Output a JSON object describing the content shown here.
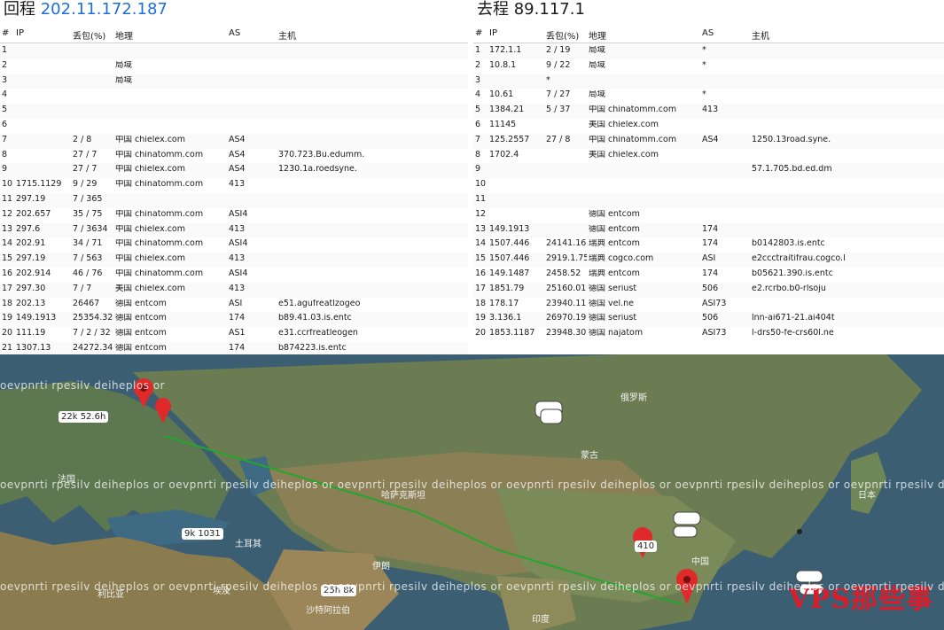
{
  "left": {
    "title_prefix": "回程",
    "title_ip": "202.11.172.187",
    "headers": {
      "hop": "#",
      "ip": "IP",
      "loss": "丢包(%)",
      "geo": "地理",
      "as": "AS",
      "host": "主机"
    },
    "rows": [
      {
        "hop": "1",
        "ip": "",
        "loss": "",
        "geo": "",
        "as": "",
        "host": ""
      },
      {
        "hop": "2",
        "ip": "",
        "loss": "",
        "geo": "局域",
        "as": "",
        "host": ""
      },
      {
        "hop": "3",
        "ip": "",
        "loss": "",
        "geo": "局域",
        "as": "",
        "host": ""
      },
      {
        "hop": "4",
        "ip": "",
        "loss": "",
        "geo": "",
        "as": "",
        "host": ""
      },
      {
        "hop": "5",
        "ip": "",
        "loss": "",
        "geo": "",
        "as": "",
        "host": ""
      },
      {
        "hop": "6",
        "ip": "",
        "loss": "",
        "geo": "",
        "as": "",
        "host": ""
      },
      {
        "hop": "7",
        "ip": "",
        "loss": "2 / 8",
        "geo": "中国 chielex.com",
        "as": "AS4",
        "host": ""
      },
      {
        "hop": "8",
        "ip": "",
        "loss": "27 / 7",
        "geo": "中国 chinatomm.com",
        "as": "AS4",
        "host": "370.723.Bu.edumm."
      },
      {
        "hop": "9",
        "ip": "",
        "loss": "27 / 7",
        "geo": "中国 chielex.com",
        "as": "AS4",
        "host": "1230.1a.roedsyne."
      },
      {
        "hop": "10",
        "ip": "1715.1129",
        "loss": "9 / 29",
        "geo": "中国 chinatomm.com",
        "as": "413",
        "host": ""
      },
      {
        "hop": "11",
        "ip": "297.19",
        "loss": "7 / 365",
        "geo": "",
        "as": "",
        "host": ""
      },
      {
        "hop": "12",
        "ip": "202.657",
        "loss": "35 / 75",
        "geo": "中国 chinatomm.com",
        "as": "ASI4",
        "host": ""
      },
      {
        "hop": "13",
        "ip": "297.6",
        "loss": "7 / 3634",
        "geo": "中国 chielex.com",
        "as": "413",
        "host": ""
      },
      {
        "hop": "14",
        "ip": "202.91",
        "loss": "34 / 71",
        "geo": "中国 chinatomm.com",
        "as": "ASI4",
        "host": ""
      },
      {
        "hop": "15",
        "ip": "297.19",
        "loss": "7 / 563",
        "geo": "中国 chielex.com",
        "as": "413",
        "host": ""
      },
      {
        "hop": "16",
        "ip": "202.914",
        "loss": "46 / 76",
        "geo": "中国 chinatomm.com",
        "as": "ASI4",
        "host": ""
      },
      {
        "hop": "17",
        "ip": "297.30",
        "loss": "7 / 7",
        "geo": "美国 chielex.com",
        "as": "413",
        "host": ""
      },
      {
        "hop": "18",
        "ip": "202.13",
        "loss": "26467",
        "geo": "德国 entcom",
        "as": "ASI",
        "host": "e51.agufreatlzogeo"
      },
      {
        "hop": "19",
        "ip": "149.1913",
        "loss": "25354.32",
        "geo": "德国 entcom",
        "as": "174",
        "host": "b89.41.03.is.entc"
      },
      {
        "hop": "20",
        "ip": "111.19",
        "loss": "7 / 2 / 32",
        "geo": "德国 entcom",
        "as": "AS1",
        "host": "e31.ccrfreatleogen"
      },
      {
        "hop": "21",
        "ip": "1307.13",
        "loss": "24272.34",
        "geo": "德国 entcom",
        "as": "174",
        "host": "b874223.is.entc"
      }
    ]
  },
  "right": {
    "title_prefix": "去程",
    "title_ip": "89.117.1",
    "headers": {
      "hop": "#",
      "ip": "IP",
      "loss": "丢包(%)",
      "geo": "地理",
      "as": "AS",
      "host": "主机"
    },
    "rows": [
      {
        "hop": "1",
        "ip": "172.1.1",
        "loss": "2 / 19",
        "geo": "局域",
        "as": "*",
        "host": ""
      },
      {
        "hop": "2",
        "ip": "10.8.1",
        "loss": "9 / 22",
        "geo": "局域",
        "as": "*",
        "host": ""
      },
      {
        "hop": "3",
        "ip": "",
        "loss": "*",
        "geo": "",
        "as": "",
        "host": ""
      },
      {
        "hop": "4",
        "ip": "10.61",
        "loss": "7 / 27",
        "geo": "局域",
        "as": "*",
        "host": ""
      },
      {
        "hop": "5",
        "ip": "1384.21",
        "loss": "5 / 37",
        "geo": "中国 chinatomm.com",
        "as": "413",
        "host": ""
      },
      {
        "hop": "6",
        "ip": "11145",
        "loss": "",
        "geo": "美国 chielex.com",
        "as": "",
        "host": ""
      },
      {
        "hop": "7",
        "ip": "125.2557",
        "loss": "27 / 8",
        "geo": "中国 chinatomm.com",
        "as": "AS4",
        "host": "1250.13road.syne."
      },
      {
        "hop": "8",
        "ip": "1702.4",
        "loss": "",
        "geo": "美国 chielex.com",
        "as": "",
        "host": ""
      },
      {
        "hop": "9",
        "ip": "",
        "loss": "",
        "geo": "",
        "as": "",
        "host": "57.1.705.bd.ed.dm"
      },
      {
        "hop": "10",
        "ip": "",
        "loss": "",
        "geo": "",
        "as": "",
        "host": ""
      },
      {
        "hop": "11",
        "ip": "",
        "loss": "",
        "geo": "",
        "as": "",
        "host": ""
      },
      {
        "hop": "12",
        "ip": "",
        "loss": "",
        "geo": "德国 entcom",
        "as": "",
        "host": ""
      },
      {
        "hop": "13",
        "ip": "149.1913",
        "loss": "",
        "geo": "德国 entcom",
        "as": "174",
        "host": ""
      },
      {
        "hop": "14",
        "ip": "1507.446",
        "loss": "24141.16",
        "geo": "瑞典 entcom",
        "as": "174",
        "host": "b0142803.is.entc"
      },
      {
        "hop": "15",
        "ip": "1507.446",
        "loss": "2919.1.75",
        "geo": "瑞典 cogco.com",
        "as": "ASI",
        "host": "e2ccctraitifrau.cogco.l"
      },
      {
        "hop": "16",
        "ip": "149.1487",
        "loss": "2458.52",
        "geo": "瑞典 entcom",
        "as": "174",
        "host": "b05621.390.is.entc"
      },
      {
        "hop": "17",
        "ip": "1851.79",
        "loss": "25160.01",
        "geo": "德国 seriust",
        "as": "506",
        "host": "e2.rcrbo.b0-rlsoju"
      },
      {
        "hop": "18",
        "ip": "178.17",
        "loss": "23940.11",
        "geo": "德国 vel.ne",
        "as": "ASI73",
        "host": ""
      },
      {
        "hop": "19",
        "ip": "3.136.1",
        "loss": "26970.19",
        "geo": "德国 seriust",
        "as": "506",
        "host": "lnn-ai671-21.ai404t"
      },
      {
        "hop": "20",
        "ip": "1853.1187",
        "loss": "23948.30",
        "geo": "德国 najatom",
        "as": "ASI73",
        "host": "l-drs50-fe-crs60l.ne"
      }
    ]
  },
  "map": {
    "watermark": "oevpnrti rpesilv deiheplos or",
    "labels": [
      {
        "text": "俄罗斯"
      },
      {
        "text": "蒙古"
      },
      {
        "text": "中国"
      },
      {
        "text": "日本"
      },
      {
        "text": "印度"
      },
      {
        "text": "土耳其"
      },
      {
        "text": "伊朗"
      },
      {
        "text": "沙特阿拉伯"
      },
      {
        "text": "埃及"
      },
      {
        "text": "利比亚"
      },
      {
        "text": "哈萨克斯坦"
      },
      {
        "text": "法国"
      }
    ],
    "tags": [
      {
        "text": "22k 52.6h"
      },
      {
        "text": "9k 1031"
      },
      {
        "text": "25h 8k"
      },
      {
        "text": "410"
      }
    ],
    "logo": "VPS那些事"
  }
}
